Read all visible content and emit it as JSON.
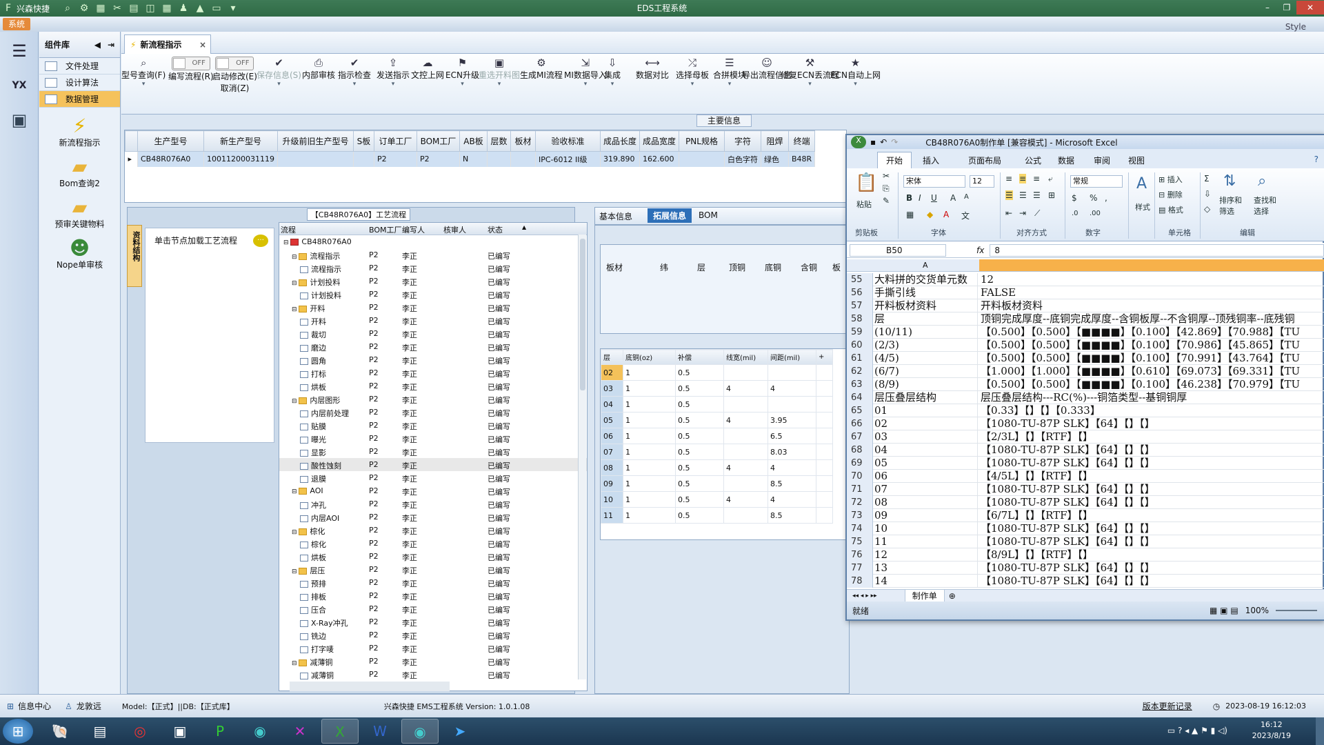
{
  "app": {
    "title": "EDS工程系统",
    "quick_title": "兴森快捷",
    "sys_tab": "系统",
    "style_label": "Style"
  },
  "sidebar": {
    "header": "组件库",
    "items": [
      {
        "label": "文件处理"
      },
      {
        "label": "设计算法"
      },
      {
        "label": "数据管理"
      }
    ],
    "big_items": [
      {
        "label": "新流程指示"
      },
      {
        "label": "Bom查询2"
      },
      {
        "label": "预审关键物料"
      },
      {
        "label": "Nope单审核"
      }
    ]
  },
  "doc_tab": {
    "label": "新流程指示"
  },
  "toolbar": {
    "items": [
      {
        "label": "型号查询(F)",
        "icon": "search-icon"
      },
      {
        "label": "编写流程(R)",
        "toggle": "OFF"
      },
      {
        "label": "启动修改(E)",
        "toggle": "OFF",
        "sub": "取消(Z)"
      },
      {
        "label": "保存信息(S)",
        "icon": "check-icon",
        "disabled": true
      },
      {
        "label": "内部审核",
        "icon": "print-icon"
      },
      {
        "label": "指示检查",
        "icon": "check-icon"
      },
      {
        "label": "发送指示",
        "icon": "upload-icon"
      },
      {
        "label": "文控上网",
        "icon": "cloud-icon"
      },
      {
        "label": "ECN升级",
        "icon": "ecn-icon"
      },
      {
        "label": "重选开料图",
        "icon": "image-icon",
        "disabled": true
      },
      {
        "label": "生成MI流程",
        "icon": "gear-icon"
      },
      {
        "label": "MI数据导入",
        "icon": "import-icon"
      },
      {
        "label": "集成",
        "icon": "download-icon"
      },
      {
        "label": "数据对比",
        "icon": "compare-icon"
      },
      {
        "label": "选择母板",
        "icon": "shuffle-icon"
      },
      {
        "label": "合拼模块",
        "icon": "list-icon"
      },
      {
        "label": "导出流程信息",
        "icon": "export-icon"
      },
      {
        "label": "修复ECN丢流程",
        "icon": "wrench-icon"
      },
      {
        "label": "ECN自动上网",
        "icon": "star-icon"
      }
    ]
  },
  "main_info_label": "主要信息",
  "top_grid": {
    "columns": [
      "生产型号",
      "新生产型号",
      "升级前旧生产型号",
      "S板",
      "订单工厂",
      "BOM工厂",
      "AB板",
      "层数",
      "板材",
      "验收标准",
      "成品长度",
      "成品宽度",
      "PNL规格",
      "字符",
      "阻焊",
      "终端"
    ],
    "row": [
      "CB48R076A0",
      "10011200031119",
      "",
      "",
      "P2",
      "P2",
      "N",
      "",
      "",
      "IPC-6012 II级",
      "319.890",
      "162.600",
      "",
      "白色字符",
      "绿色",
      "B48R"
    ]
  },
  "process_panel": {
    "caption": "【CB48R076A0】工艺流程",
    "vtab": "资料结构",
    "hint": "单击节点加载工艺流程"
  },
  "tree": {
    "columns": [
      "流程",
      "BOM工厂",
      "编写人",
      "核审人",
      "状态"
    ],
    "rows": [
      {
        "label": "CB48R076A0",
        "level": 0,
        "type": "root",
        "factory": "",
        "writer": "",
        "reviewer": "",
        "status": ""
      },
      {
        "label": "流程指示",
        "level": 1,
        "type": "folder",
        "factory": "P2",
        "writer": "李正",
        "reviewer": "",
        "status": "已编写"
      },
      {
        "label": "流程指示",
        "level": 2,
        "type": "file",
        "factory": "P2",
        "writer": "李正",
        "reviewer": "",
        "status": "已编写"
      },
      {
        "label": "计划投料",
        "level": 1,
        "type": "folder",
        "factory": "P2",
        "writer": "李正",
        "reviewer": "",
        "status": "已编写"
      },
      {
        "label": "计划投料",
        "level": 2,
        "type": "file",
        "factory": "P2",
        "writer": "李正",
        "reviewer": "",
        "status": "已编写"
      },
      {
        "label": "开料",
        "level": 1,
        "type": "folder",
        "factory": "P2",
        "writer": "李正",
        "reviewer": "",
        "status": "已编写"
      },
      {
        "label": "开料",
        "level": 2,
        "type": "file",
        "factory": "P2",
        "writer": "李正",
        "reviewer": "",
        "status": "已编写"
      },
      {
        "label": "裁切",
        "level": 2,
        "type": "file",
        "factory": "P2",
        "writer": "李正",
        "reviewer": "",
        "status": "已编写"
      },
      {
        "label": "磨边",
        "level": 2,
        "type": "file",
        "factory": "P2",
        "writer": "李正",
        "reviewer": "",
        "status": "已编写"
      },
      {
        "label": "圆角",
        "level": 2,
        "type": "file",
        "factory": "P2",
        "writer": "李正",
        "reviewer": "",
        "status": "已编写"
      },
      {
        "label": "打标",
        "level": 2,
        "type": "file",
        "factory": "P2",
        "writer": "李正",
        "reviewer": "",
        "status": "已编写"
      },
      {
        "label": "烘板",
        "level": 2,
        "type": "file",
        "factory": "P2",
        "writer": "李正",
        "reviewer": "",
        "status": "已编写"
      },
      {
        "label": "内层图形",
        "level": 1,
        "type": "folder",
        "factory": "P2",
        "writer": "李正",
        "reviewer": "",
        "status": "已编写"
      },
      {
        "label": "内层前处理",
        "level": 2,
        "type": "file",
        "factory": "P2",
        "writer": "李正",
        "reviewer": "",
        "status": "已编写"
      },
      {
        "label": "贴膜",
        "level": 2,
        "type": "file",
        "factory": "P2",
        "writer": "李正",
        "reviewer": "",
        "status": "已编写"
      },
      {
        "label": "曝光",
        "level": 2,
        "type": "file",
        "factory": "P2",
        "writer": "李正",
        "reviewer": "",
        "status": "已编写"
      },
      {
        "label": "显影",
        "level": 2,
        "type": "file",
        "factory": "P2",
        "writer": "李正",
        "reviewer": "",
        "status": "已编写"
      },
      {
        "label": "酸性蚀刻",
        "level": 2,
        "type": "file",
        "factory": "P2",
        "writer": "李正",
        "reviewer": "",
        "status": "已编写",
        "hl": true
      },
      {
        "label": "退膜",
        "level": 2,
        "type": "file",
        "factory": "P2",
        "writer": "李正",
        "reviewer": "",
        "status": "已编写"
      },
      {
        "label": "AOI",
        "level": 1,
        "type": "folder",
        "factory": "P2",
        "writer": "李正",
        "reviewer": "",
        "status": "已编写"
      },
      {
        "label": "冲孔",
        "level": 2,
        "type": "file",
        "factory": "P2",
        "writer": "李正",
        "reviewer": "",
        "status": "已编写"
      },
      {
        "label": "内层AOI",
        "level": 2,
        "type": "file",
        "factory": "P2",
        "writer": "李正",
        "reviewer": "",
        "status": "已编写"
      },
      {
        "label": "棕化",
        "level": 1,
        "type": "folder",
        "factory": "P2",
        "writer": "李正",
        "reviewer": "",
        "status": "已编写"
      },
      {
        "label": "棕化",
        "level": 2,
        "type": "file",
        "factory": "P2",
        "writer": "李正",
        "reviewer": "",
        "status": "已编写"
      },
      {
        "label": "烘板",
        "level": 2,
        "type": "file",
        "factory": "P2",
        "writer": "李正",
        "reviewer": "",
        "status": "已编写"
      },
      {
        "label": "层压",
        "level": 1,
        "type": "folder",
        "factory": "P2",
        "writer": "李正",
        "reviewer": "",
        "status": "已编写"
      },
      {
        "label": "预排",
        "level": 2,
        "type": "file",
        "factory": "P2",
        "writer": "李正",
        "reviewer": "",
        "status": "已编写"
      },
      {
        "label": "排板",
        "level": 2,
        "type": "file",
        "factory": "P2",
        "writer": "李正",
        "reviewer": "",
        "status": "已编写"
      },
      {
        "label": "压合",
        "level": 2,
        "type": "file",
        "factory": "P2",
        "writer": "李正",
        "reviewer": "",
        "status": "已编写"
      },
      {
        "label": "X-Ray冲孔",
        "level": 2,
        "type": "file",
        "factory": "P2",
        "writer": "李正",
        "reviewer": "",
        "status": "已编写"
      },
      {
        "label": "铣边",
        "level": 2,
        "type": "file",
        "factory": "P2",
        "writer": "李正",
        "reviewer": "",
        "status": "已编写"
      },
      {
        "label": "打字唛",
        "level": 2,
        "type": "file",
        "factory": "P2",
        "writer": "李正",
        "reviewer": "",
        "status": "已编写"
      },
      {
        "label": "减薄铜",
        "level": 1,
        "type": "folder",
        "factory": "P2",
        "writer": "李正",
        "reviewer": "",
        "status": "已编写"
      },
      {
        "label": "减薄铜",
        "level": 2,
        "type": "file",
        "factory": "P2",
        "writer": "李正",
        "reviewer": "",
        "status": "已编写"
      }
    ]
  },
  "mid_tabs": [
    {
      "label": "基本信息"
    },
    {
      "label": "拓展信息",
      "selected": true
    },
    {
      "label": "BOM"
    }
  ],
  "sheet_headers": [
    "板材",
    "纬",
    "层",
    "顶铜",
    "底铜",
    "含铜",
    "板"
  ],
  "layer_grid": {
    "columns": [
      "层",
      "底铜(oz)",
      "补偿",
      "线宽(mil)",
      "间距(mil)",
      "+"
    ],
    "rows": [
      [
        "02",
        "1",
        "0.5",
        "",
        ""
      ],
      [
        "03",
        "1",
        "0.5",
        "4",
        "4"
      ],
      [
        "04",
        "1",
        "0.5",
        "",
        ""
      ],
      [
        "05",
        "1",
        "0.5",
        "4",
        "3.95"
      ],
      [
        "06",
        "1",
        "0.5",
        "",
        "6.5"
      ],
      [
        "07",
        "1",
        "0.5",
        "",
        "8.03"
      ],
      [
        "08",
        "1",
        "0.5",
        "4",
        "4"
      ],
      [
        "09",
        "1",
        "0.5",
        "",
        "8.5"
      ],
      [
        "10",
        "1",
        "0.5",
        "4",
        "4"
      ],
      [
        "11",
        "1",
        "0.5",
        "",
        "8.5"
      ]
    ]
  },
  "excel": {
    "title": "CB48R076A0制作单 [兼容模式] - Microsoft Excel",
    "tabs": [
      "开始",
      "插入",
      "页面布局",
      "公式",
      "数据",
      "审阅",
      "视图"
    ],
    "font_name": "宋体",
    "font_size": "12",
    "number_format": "常规",
    "groups": [
      "剪贴板",
      "字体",
      "对齐方式",
      "数字",
      "单元格",
      "编辑"
    ],
    "buttons": {
      "paste": "粘贴",
      "style": "样式",
      "insert": "插入",
      "delete": "删除",
      "format": "格式",
      "sort": "排序和\n筛选",
      "find": "查找和\n选择"
    },
    "cell_ref": "B50",
    "formula": "8",
    "col_a": "A",
    "rows": [
      {
        "n": "55",
        "a": "大料拼的交货单元数",
        "b": "12"
      },
      {
        "n": "56",
        "a": "手撕引线",
        "b": "FALSE"
      },
      {
        "n": "57",
        "a": "开料板材资料",
        "b": "开料板材资料"
      },
      {
        "n": "58",
        "a": "层",
        "b": "顶铜完成厚度--底铜完成厚度--含铜板厚--不含铜厚--顶残铜率--底残铜"
      },
      {
        "n": "59",
        "a": "(10/11)",
        "b": "【0.500】【0.500】【■■■■】【0.100】【42.869】【70.988】【TU"
      },
      {
        "n": "60",
        "a": "(2/3)",
        "b": "【0.500】【0.500】【■■■■】【0.100】【70.986】【45.865】【TU"
      },
      {
        "n": "61",
        "a": "(4/5)",
        "b": "【0.500】【0.500】【■■■■】【0.100】【70.991】【43.764】【TU"
      },
      {
        "n": "62",
        "a": "(6/7)",
        "b": "【1.000】【1.000】【■■■■】【0.610】【69.073】【69.331】【TU"
      },
      {
        "n": "63",
        "a": "(8/9)",
        "b": "【0.500】【0.500】【■■■■】【0.100】【46.238】【70.979】【TU"
      },
      {
        "n": "64",
        "a": "层压叠层结构",
        "b": "层压叠层结构---RC(%)---铜箔类型--基铜铜厚"
      },
      {
        "n": "65",
        "a": "01",
        "b": "【0.33】【】【】【0.333】"
      },
      {
        "n": "66",
        "a": "02",
        "b": "【1080-TU-87P SLK】【64】【】【】"
      },
      {
        "n": "67",
        "a": "03",
        "b": "【2/3L】【】【RTF】【】"
      },
      {
        "n": "68",
        "a": "04",
        "b": "【1080-TU-87P SLK】【64】【】【】"
      },
      {
        "n": "69",
        "a": "05",
        "b": "【1080-TU-87P SLK】【64】【】【】"
      },
      {
        "n": "70",
        "a": "06",
        "b": "【4/5L】【】【RTF】【】"
      },
      {
        "n": "71",
        "a": "07",
        "b": "【1080-TU-87P SLK】【64】【】【】"
      },
      {
        "n": "72",
        "a": "08",
        "b": "【1080-TU-87P SLK】【64】【】【】"
      },
      {
        "n": "73",
        "a": "09",
        "b": "【6/7L】【】【RTF】【】"
      },
      {
        "n": "74",
        "a": "10",
        "b": "【1080-TU-87P SLK】【64】【】【】"
      },
      {
        "n": "75",
        "a": "11",
        "b": "【1080-TU-87P SLK】【64】【】【】"
      },
      {
        "n": "76",
        "a": "12",
        "b": "【8/9L】【】【RTF】【】"
      },
      {
        "n": "77",
        "a": "13",
        "b": "【1080-TU-87P SLK】【64】【】【】"
      },
      {
        "n": "78",
        "a": "14",
        "b": "【1080-TU-87P SLK】【64】【】【】"
      }
    ],
    "sheet_tab": "制作单",
    "status": "就绪",
    "zoom": "100%"
  },
  "statusbar": {
    "info_center": "信息中心",
    "user": "龙敦远",
    "model": "Model:【正式】||DB:【正式库】",
    "version": "兴森快捷 EMS工程系统 Version: 1.0.1.08",
    "update_log": "版本更新记录",
    "datetime": "2023-08-19 16:12:03"
  },
  "clock": {
    "time": "16:12",
    "date": "2023/8/19"
  }
}
